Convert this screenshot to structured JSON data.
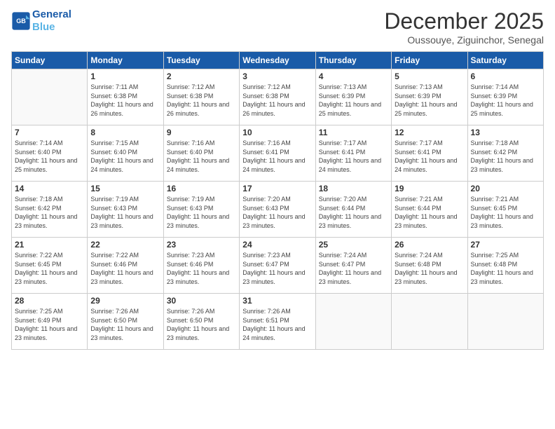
{
  "logo": {
    "line1": "General",
    "line2": "Blue"
  },
  "header": {
    "title": "December 2025",
    "subtitle": "Oussouye, Ziguinchor, Senegal"
  },
  "weekdays": [
    "Sunday",
    "Monday",
    "Tuesday",
    "Wednesday",
    "Thursday",
    "Friday",
    "Saturday"
  ],
  "weeks": [
    [
      {
        "day": "",
        "sunrise": "",
        "sunset": "",
        "daylight": ""
      },
      {
        "day": "1",
        "sunrise": "Sunrise: 7:11 AM",
        "sunset": "Sunset: 6:38 PM",
        "daylight": "Daylight: 11 hours and 26 minutes."
      },
      {
        "day": "2",
        "sunrise": "Sunrise: 7:12 AM",
        "sunset": "Sunset: 6:38 PM",
        "daylight": "Daylight: 11 hours and 26 minutes."
      },
      {
        "day": "3",
        "sunrise": "Sunrise: 7:12 AM",
        "sunset": "Sunset: 6:38 PM",
        "daylight": "Daylight: 11 hours and 26 minutes."
      },
      {
        "day": "4",
        "sunrise": "Sunrise: 7:13 AM",
        "sunset": "Sunset: 6:39 PM",
        "daylight": "Daylight: 11 hours and 25 minutes."
      },
      {
        "day": "5",
        "sunrise": "Sunrise: 7:13 AM",
        "sunset": "Sunset: 6:39 PM",
        "daylight": "Daylight: 11 hours and 25 minutes."
      },
      {
        "day": "6",
        "sunrise": "Sunrise: 7:14 AM",
        "sunset": "Sunset: 6:39 PM",
        "daylight": "Daylight: 11 hours and 25 minutes."
      }
    ],
    [
      {
        "day": "7",
        "sunrise": "Sunrise: 7:14 AM",
        "sunset": "Sunset: 6:40 PM",
        "daylight": "Daylight: 11 hours and 25 minutes."
      },
      {
        "day": "8",
        "sunrise": "Sunrise: 7:15 AM",
        "sunset": "Sunset: 6:40 PM",
        "daylight": "Daylight: 11 hours and 24 minutes."
      },
      {
        "day": "9",
        "sunrise": "Sunrise: 7:16 AM",
        "sunset": "Sunset: 6:40 PM",
        "daylight": "Daylight: 11 hours and 24 minutes."
      },
      {
        "day": "10",
        "sunrise": "Sunrise: 7:16 AM",
        "sunset": "Sunset: 6:41 PM",
        "daylight": "Daylight: 11 hours and 24 minutes."
      },
      {
        "day": "11",
        "sunrise": "Sunrise: 7:17 AM",
        "sunset": "Sunset: 6:41 PM",
        "daylight": "Daylight: 11 hours and 24 minutes."
      },
      {
        "day": "12",
        "sunrise": "Sunrise: 7:17 AM",
        "sunset": "Sunset: 6:41 PM",
        "daylight": "Daylight: 11 hours and 24 minutes."
      },
      {
        "day": "13",
        "sunrise": "Sunrise: 7:18 AM",
        "sunset": "Sunset: 6:42 PM",
        "daylight": "Daylight: 11 hours and 23 minutes."
      }
    ],
    [
      {
        "day": "14",
        "sunrise": "Sunrise: 7:18 AM",
        "sunset": "Sunset: 6:42 PM",
        "daylight": "Daylight: 11 hours and 23 minutes."
      },
      {
        "day": "15",
        "sunrise": "Sunrise: 7:19 AM",
        "sunset": "Sunset: 6:43 PM",
        "daylight": "Daylight: 11 hours and 23 minutes."
      },
      {
        "day": "16",
        "sunrise": "Sunrise: 7:19 AM",
        "sunset": "Sunset: 6:43 PM",
        "daylight": "Daylight: 11 hours and 23 minutes."
      },
      {
        "day": "17",
        "sunrise": "Sunrise: 7:20 AM",
        "sunset": "Sunset: 6:43 PM",
        "daylight": "Daylight: 11 hours and 23 minutes."
      },
      {
        "day": "18",
        "sunrise": "Sunrise: 7:20 AM",
        "sunset": "Sunset: 6:44 PM",
        "daylight": "Daylight: 11 hours and 23 minutes."
      },
      {
        "day": "19",
        "sunrise": "Sunrise: 7:21 AM",
        "sunset": "Sunset: 6:44 PM",
        "daylight": "Daylight: 11 hours and 23 minutes."
      },
      {
        "day": "20",
        "sunrise": "Sunrise: 7:21 AM",
        "sunset": "Sunset: 6:45 PM",
        "daylight": "Daylight: 11 hours and 23 minutes."
      }
    ],
    [
      {
        "day": "21",
        "sunrise": "Sunrise: 7:22 AM",
        "sunset": "Sunset: 6:45 PM",
        "daylight": "Daylight: 11 hours and 23 minutes."
      },
      {
        "day": "22",
        "sunrise": "Sunrise: 7:22 AM",
        "sunset": "Sunset: 6:46 PM",
        "daylight": "Daylight: 11 hours and 23 minutes."
      },
      {
        "day": "23",
        "sunrise": "Sunrise: 7:23 AM",
        "sunset": "Sunset: 6:46 PM",
        "daylight": "Daylight: 11 hours and 23 minutes."
      },
      {
        "day": "24",
        "sunrise": "Sunrise: 7:23 AM",
        "sunset": "Sunset: 6:47 PM",
        "daylight": "Daylight: 11 hours and 23 minutes."
      },
      {
        "day": "25",
        "sunrise": "Sunrise: 7:24 AM",
        "sunset": "Sunset: 6:47 PM",
        "daylight": "Daylight: 11 hours and 23 minutes."
      },
      {
        "day": "26",
        "sunrise": "Sunrise: 7:24 AM",
        "sunset": "Sunset: 6:48 PM",
        "daylight": "Daylight: 11 hours and 23 minutes."
      },
      {
        "day": "27",
        "sunrise": "Sunrise: 7:25 AM",
        "sunset": "Sunset: 6:48 PM",
        "daylight": "Daylight: 11 hours and 23 minutes."
      }
    ],
    [
      {
        "day": "28",
        "sunrise": "Sunrise: 7:25 AM",
        "sunset": "Sunset: 6:49 PM",
        "daylight": "Daylight: 11 hours and 23 minutes."
      },
      {
        "day": "29",
        "sunrise": "Sunrise: 7:26 AM",
        "sunset": "Sunset: 6:50 PM",
        "daylight": "Daylight: 11 hours and 23 minutes."
      },
      {
        "day": "30",
        "sunrise": "Sunrise: 7:26 AM",
        "sunset": "Sunset: 6:50 PM",
        "daylight": "Daylight: 11 hours and 23 minutes."
      },
      {
        "day": "31",
        "sunrise": "Sunrise: 7:26 AM",
        "sunset": "Sunset: 6:51 PM",
        "daylight": "Daylight: 11 hours and 24 minutes."
      },
      {
        "day": "",
        "sunrise": "",
        "sunset": "",
        "daylight": ""
      },
      {
        "day": "",
        "sunrise": "",
        "sunset": "",
        "daylight": ""
      },
      {
        "day": "",
        "sunrise": "",
        "sunset": "",
        "daylight": ""
      }
    ]
  ]
}
